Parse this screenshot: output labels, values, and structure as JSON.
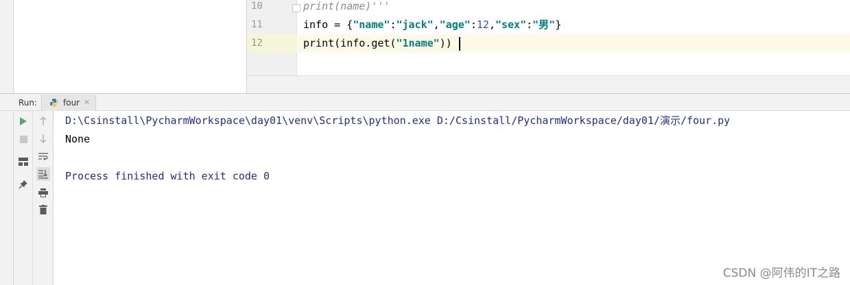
{
  "editor": {
    "lines": [
      {
        "number": "10",
        "text": "print(name)'''"
      },
      {
        "number": "11",
        "parts": [
          "info = {",
          "\"name\"",
          ":",
          "\"jack\"",
          ",",
          "\"age\"",
          ":",
          "12",
          ",",
          "\"sex\"",
          ":",
          "\"男\"",
          "}"
        ]
      },
      {
        "number": "12",
        "parts": [
          "print(info.get(",
          "\"1name\"",
          "))"
        ]
      }
    ]
  },
  "run": {
    "label": "Run:",
    "tab_label": "four",
    "close_glyph": "✕",
    "icons": [
      "run-icon",
      "stop-icon",
      "layout-icon",
      "pin-icon",
      "up-arrow-icon",
      "down-arrow-icon",
      "soft-wrap-icon",
      "scroll-to-end-icon",
      "print-icon",
      "trash-icon"
    ],
    "console": {
      "command": "D:\\Csinstall\\PycharmWorkspace\\day01\\venv\\Scripts\\python.exe D:/Csinstall/PycharmWorkspace/day01/演示/four.py",
      "output": "None",
      "exit_message": "Process finished with exit code 0"
    }
  },
  "watermark": "CSDN @阿伟的IT之路",
  "colors": {
    "string": "#067d17",
    "number": "#1750eb",
    "console_system": "#1f2e96",
    "current_line": "#fcfae6",
    "run_green": "#59a869"
  }
}
